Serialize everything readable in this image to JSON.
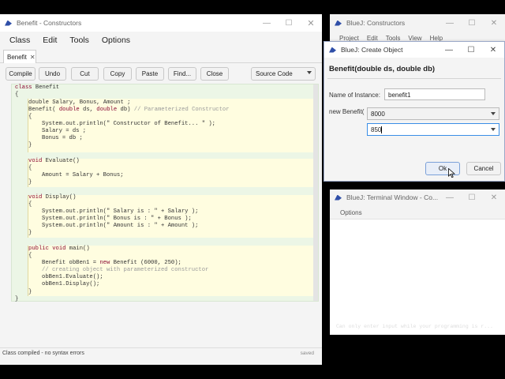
{
  "editor": {
    "title": "Benefit - Constructors",
    "menu": [
      "Class",
      "Edit",
      "Tools",
      "Options"
    ],
    "tab": "Benefit",
    "toolbar": {
      "compile": "Compile",
      "undo": "Undo",
      "cut": "Cut",
      "copy": "Copy",
      "paste": "Paste",
      "find": "Find...",
      "close": "Close",
      "view_mode": "Source Code"
    },
    "code": {
      "l1a": "class",
      "l1b": " Benefit",
      "l2": "{",
      "l3": "double Salary, Bonus, Amount ;",
      "l4a": "Benefit( ",
      "l4b": "double",
      "l4c": " ds, ",
      "l4d": "double",
      "l4e": " db) ",
      "l4f": "// Parameterized Constructor",
      "l5": "{",
      "l6": "System.out.println(\" Constructor of Benefit... \" );",
      "l7": "Salary = ds ;",
      "l8": "Bonus = db ;",
      "l9": "}",
      "l10a": "void",
      "l10b": " Evaluate()",
      "l11": "{",
      "l12": "Amount = Salary + Bonus;",
      "l13": "}",
      "l14a": "void",
      "l14b": " Display()",
      "l15": "{",
      "l16": "System.out.println(\" Salary is : \" + Salary );",
      "l17": "System.out.println(\" Bonus is : \" + Bonus );",
      "l18": "System.out.println(\" Amount is : \" + Amount );",
      "l19": "}",
      "l20a": "public void",
      "l20b": " main()",
      "l21": "{",
      "l22a": "Benefit obBen1 = ",
      "l22b": "new",
      "l22c": " Benefit (6000, 250);",
      "l23": "// creating object with parameterized constructor",
      "l24": "obBen1.Evaluate();",
      "l25": "obBen1.Display();",
      "l26": "}",
      "l27": "}"
    },
    "status": "Class compiled - no syntax errors",
    "status_right": "saved"
  },
  "bluej_main": {
    "title": "BlueJ: Constructors",
    "menu": [
      "Project",
      "Edit",
      "Tools",
      "View",
      "Help"
    ]
  },
  "dialog": {
    "title": "BlueJ: Create Object",
    "heading": "Benefit(double ds, double db)",
    "name_label": "Name of Instance:",
    "name_value": "benefit1",
    "new_label": "new Benefit(",
    "arg1": "8000",
    "arg2": "850",
    "ok": "Ok",
    "cancel": "Cancel"
  },
  "terminal": {
    "title": "BlueJ: Terminal Window - Co...",
    "menu": "Options",
    "hint": "Can only enter input while your programming is r..."
  },
  "colors": {
    "accent": "#2f4fa8",
    "code_bg": "#ecf6e6",
    "block_bg": "#fffde0",
    "keyword": "#8a0a33"
  }
}
